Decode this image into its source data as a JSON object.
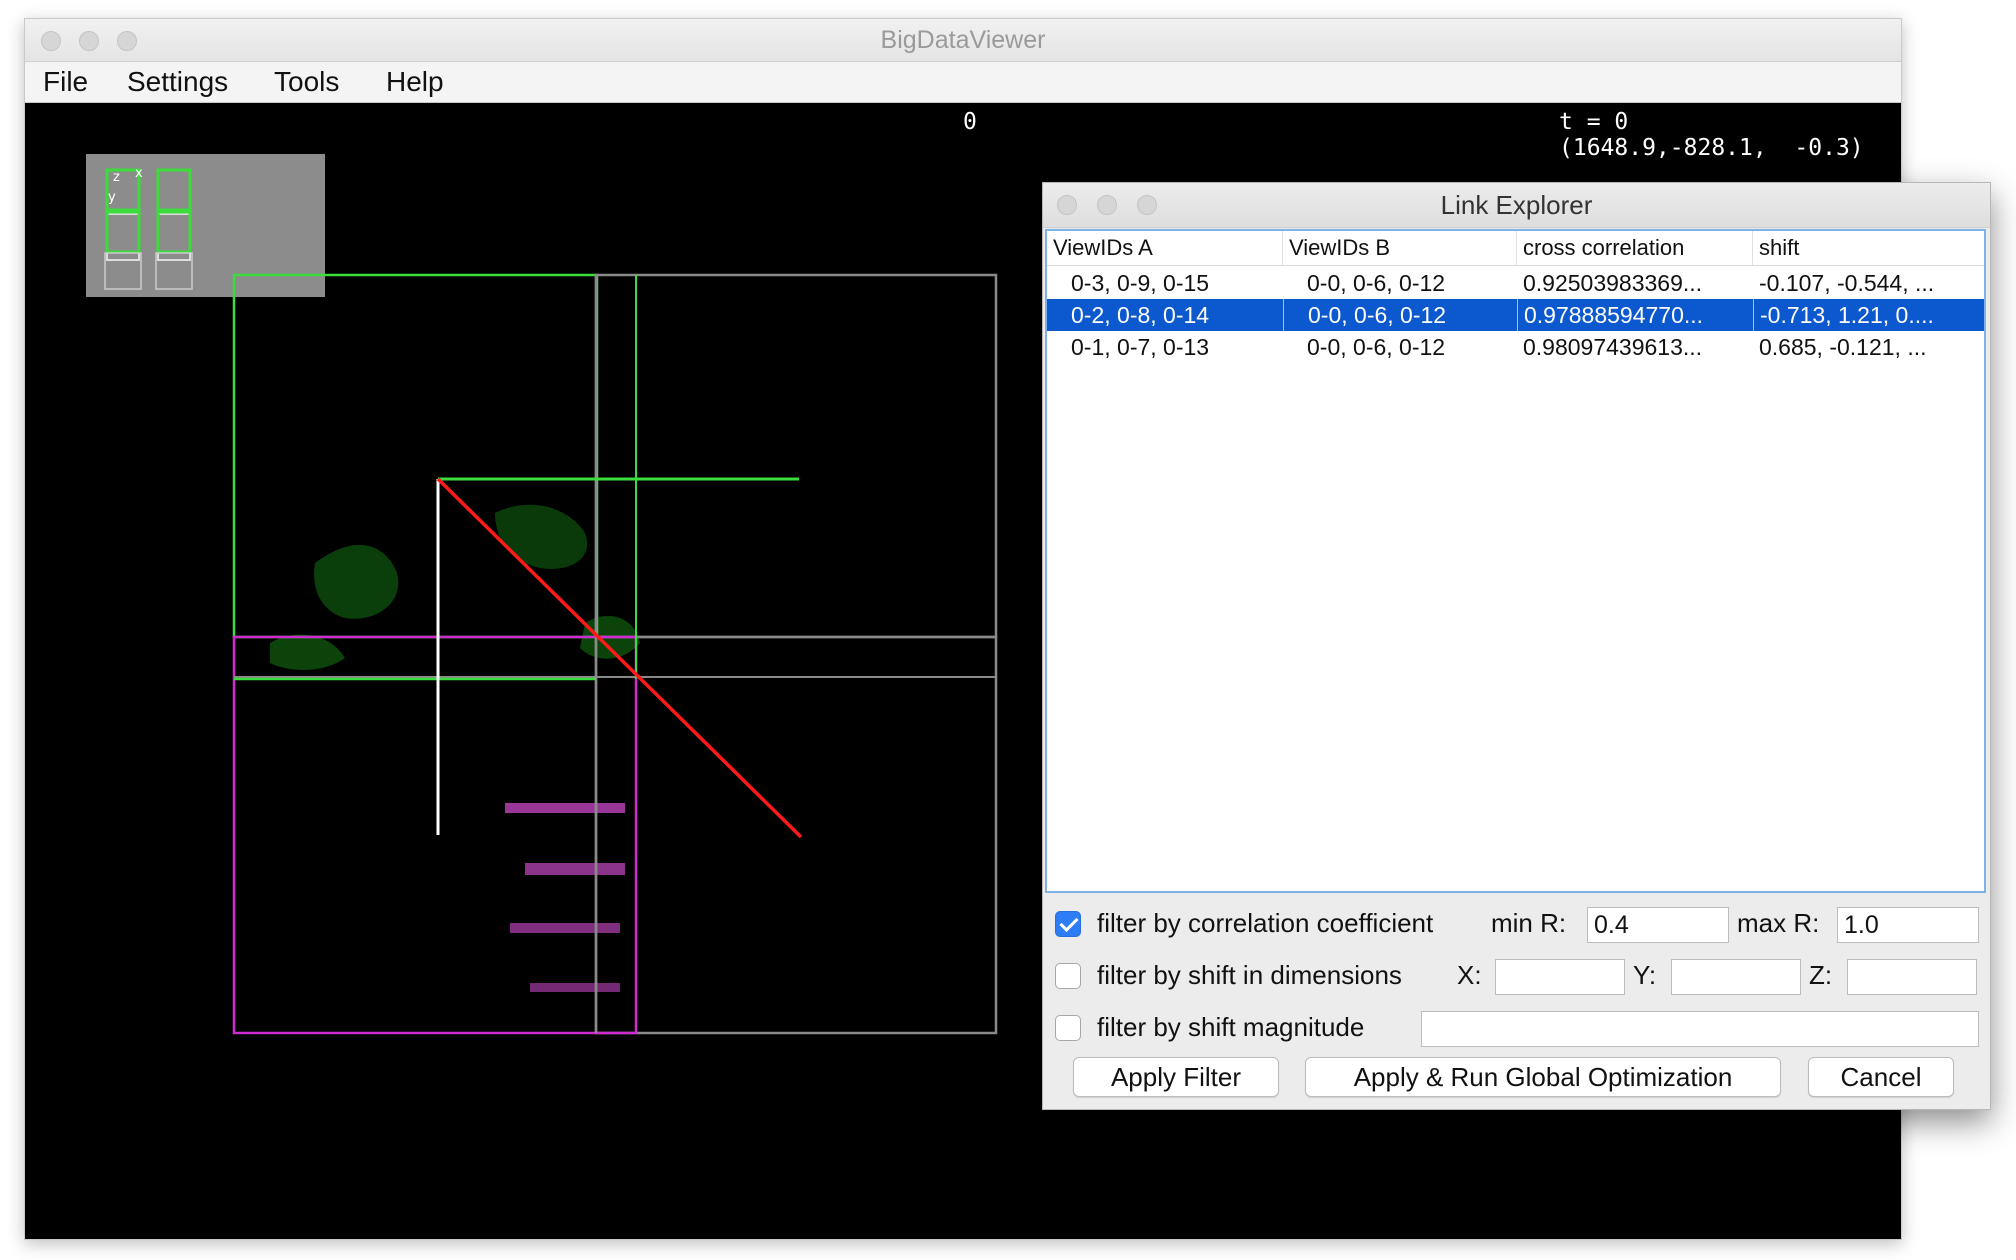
{
  "main_window": {
    "title": "BigDataViewer",
    "menu": [
      "File",
      "Settings",
      "Tools",
      "Help"
    ],
    "overlay": {
      "source_index": "0",
      "time": "t = 0",
      "coordinates": "(1648.9,-828.1,  -0.3)"
    },
    "navigator_axes": {
      "z": "z",
      "x": "x",
      "y": "y"
    }
  },
  "dialog": {
    "title": "Link Explorer",
    "columns": [
      "ViewIDs A",
      "ViewIDs B",
      "cross correlation",
      "shift"
    ],
    "rows": [
      [
        "0-3, 0-9, 0-15",
        "0-0, 0-6, 0-12",
        "0.92503983369...",
        "-0.107, -0.544, ..."
      ],
      [
        "0-2, 0-8, 0-14",
        "0-0, 0-6, 0-12",
        "0.97888594770...",
        "-0.713, 1.21, 0...."
      ],
      [
        "0-1, 0-7, 0-13",
        "0-0, 0-6, 0-12",
        "0.98097439613...",
        "0.685, -0.121, ..."
      ]
    ],
    "selected_row": 1,
    "filters": {
      "correlation": {
        "label": "filter by correlation coefficient",
        "checked": true,
        "min_label": "min R:",
        "min_value": "0.4",
        "max_label": "max R:",
        "max_value": "1.0"
      },
      "shift_dims": {
        "label": "filter by shift in dimensions",
        "checked": false,
        "x_label": "X:",
        "y_label": "Y:",
        "z_label": "Z:",
        "x_value": "",
        "y_value": "",
        "z_value": ""
      },
      "shift_magnitude": {
        "label": "filter by shift magnitude",
        "checked": false,
        "value": ""
      }
    },
    "buttons": {
      "apply_filter": "Apply Filter",
      "apply_run": "Apply & Run Global Optimization",
      "cancel": "Cancel"
    }
  },
  "colors": {
    "selection": "#0c59cf",
    "green_tile": "#3ddc3d",
    "magenta_tile": "#d02bd0",
    "link_line": "#ff1a1a"
  }
}
